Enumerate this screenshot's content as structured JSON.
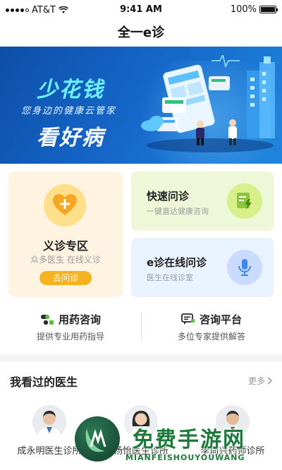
{
  "status_bar": {
    "carrier": "AT&T",
    "time": "9:41 AM",
    "battery": "100%",
    "battery_level": 1.0
  },
  "nav": {
    "title": "全一e诊"
  },
  "banner": {
    "headline_1": "少花钱",
    "tagline": "您身边的健康云管家",
    "headline_2": "看好病",
    "slides": 3,
    "active_slide": 1
  },
  "cards": {
    "yizhen": {
      "title": "义诊专区",
      "subtitle": "众多医生 在线义诊",
      "button": "去问诊"
    },
    "kuaisu": {
      "title": "快速问诊",
      "subtitle": "一键直达健康咨询"
    },
    "ezhen": {
      "title": "e诊在线问诊",
      "subtitle": "医生在线诊室"
    }
  },
  "services": [
    {
      "title": "用药咨询",
      "subtitle": "提供专业用药指导",
      "icon": "pill-icon"
    },
    {
      "title": "咨询平台",
      "subtitle": "多位专家提供解答",
      "icon": "chat-icon"
    }
  ],
  "recent_doctors": {
    "title": "我看过的医生",
    "more": "更多",
    "doctors": [
      {
        "name": "成永明医生诊所"
      },
      {
        "name": "杨怡医生诊所"
      },
      {
        "name": "李尚兴药师诊所"
      }
    ]
  },
  "watermark": {
    "text": "免费手游网",
    "subtext": "MIANFEISHOUYOUWANG"
  },
  "colors": {
    "accent_orange": "#f5b321",
    "banner_blue": "#1565c7",
    "green_card": "#eef8d9",
    "blue_card": "#e9f3ff",
    "orange_card": "#fff4e2"
  }
}
